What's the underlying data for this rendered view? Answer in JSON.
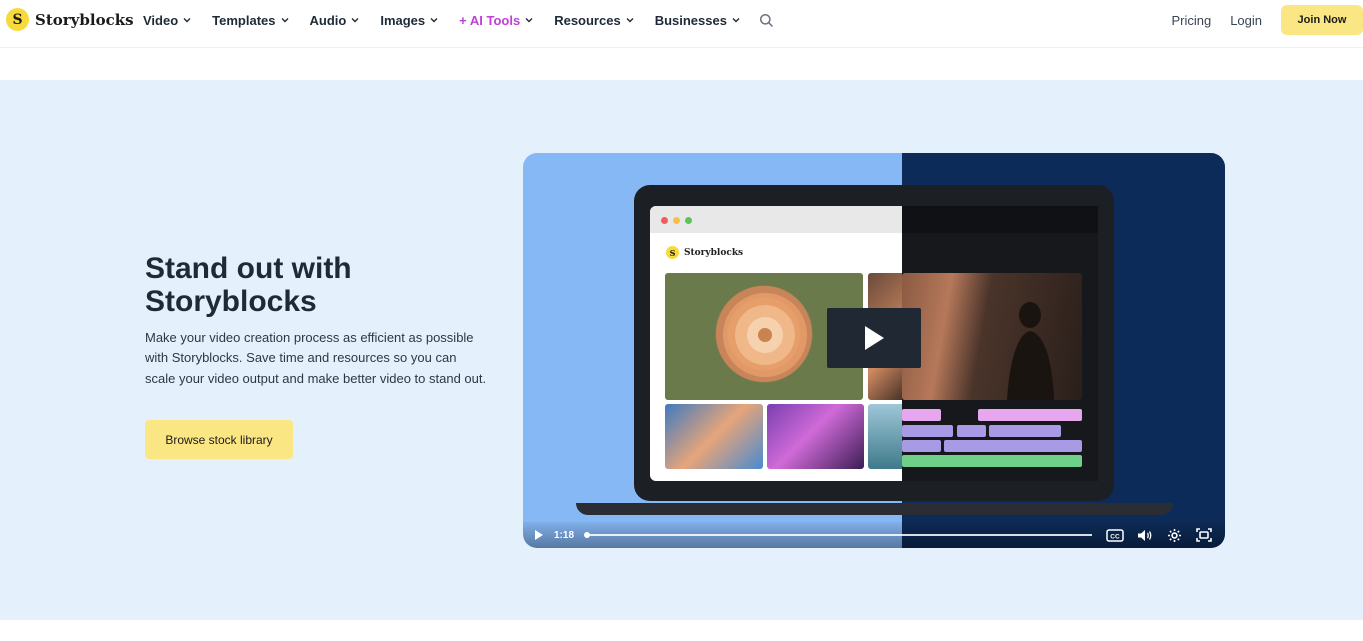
{
  "brand": {
    "name": "Storyblocks",
    "mark": "S",
    "color": "#f7db3b"
  },
  "nav": {
    "items": [
      {
        "label": "Video",
        "dropdown": true
      },
      {
        "label": "Templates",
        "dropdown": true
      },
      {
        "label": "Audio",
        "dropdown": true
      },
      {
        "label": "Images",
        "dropdown": true
      },
      {
        "label": "+ AI Tools",
        "dropdown": true,
        "accent": "#c03fd6"
      },
      {
        "label": "Resources",
        "dropdown": true
      },
      {
        "label": "Businesses",
        "dropdown": true
      }
    ],
    "pricing_label": "Pricing",
    "login_label": "Login",
    "join_label": "Join Now"
  },
  "hero": {
    "title": "Stand out with Storyblocks",
    "description": "Make your video creation process as efficient as possible with Storyblocks. Save time and resources so you can scale your video output and make better video to stand out.",
    "cta_label": "Browse stock library",
    "background": "#e4f1fd"
  },
  "player": {
    "time": "1:18",
    "progress_fraction": 0.0,
    "screen_brand": "Storyblocks",
    "icons": [
      "play-icon",
      "captions-icon",
      "volume-icon",
      "settings-icon",
      "fullscreen-icon"
    ]
  },
  "colors": {
    "cta_yellow": "#fbe684",
    "player_light": "#86b8f6",
    "player_dark": "#0d2b58"
  }
}
